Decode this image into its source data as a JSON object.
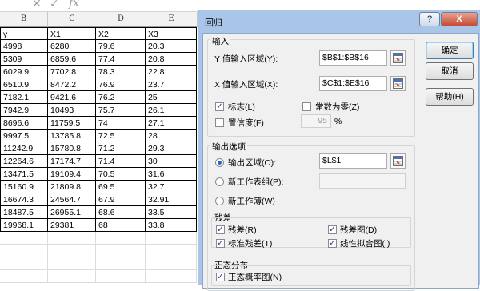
{
  "toolbar": {
    "cancel_icon": "x-icon",
    "enter_icon": "check-icon",
    "fx_label": "fx"
  },
  "columns": [
    "B",
    "C",
    "D",
    "E"
  ],
  "rows": [
    [
      "y",
      "X1",
      "X2",
      "X3"
    ],
    [
      "4998",
      "6280",
      "79.6",
      "20.3"
    ],
    [
      "5309",
      "6859.6",
      "77.4",
      "20.8"
    ],
    [
      "6029.9",
      "7702.8",
      "78.3",
      "22.8"
    ],
    [
      "6510.9",
      "8472.2",
      "76.9",
      "23.7"
    ],
    [
      "7182.1",
      "9421.6",
      "76.2",
      "25"
    ],
    [
      "7942.9",
      "10493",
      "75.7",
      "26.1"
    ],
    [
      "8696.6",
      "11759.5",
      "74",
      "27.1"
    ],
    [
      "9997.5",
      "13785.8",
      "72.5",
      "28"
    ],
    [
      "11242.9",
      "15780.8",
      "71.2",
      "29.3"
    ],
    [
      "12264.6",
      "17174.7",
      "71.4",
      "30"
    ],
    [
      "13471.5",
      "19109.4",
      "70.5",
      "31.6"
    ],
    [
      "15160.9",
      "21809.8",
      "69.5",
      "32.7"
    ],
    [
      "16674.3",
      "24564.7",
      "67.9",
      "32.91"
    ],
    [
      "18487.5",
      "26955.1",
      "68.6",
      "33.5"
    ],
    [
      "19968.1",
      "29381",
      "68",
      "33.8"
    ]
  ],
  "dialog": {
    "title": "回归",
    "help_btn": "?",
    "close_btn": "X",
    "input_group": "输入",
    "y_label": "Y 值输入区域(Y):",
    "y_value": "$B$1:$B$16",
    "x_label": "X 值输入区域(X):",
    "x_value": "$C$1:$E$16",
    "labels_chk": "标志(L)",
    "labels_checked": true,
    "const_zero_chk": "常数为零(Z)",
    "const_zero_checked": false,
    "confidence_chk": "置信度(F)",
    "confidence_checked": false,
    "confidence_value": "95",
    "percent": "%",
    "output_group": "输出选项",
    "out_range_label": "输出区域(O):",
    "out_range_value": "$L$1",
    "new_sheet_label": "新工作表组(P):",
    "new_book_label": "新工作薄(W)",
    "selected_output": "output_range",
    "residuals_title": "残差",
    "residuals_chk": "残差(R)",
    "std_residuals_chk": "标准残差(T)",
    "residual_plot_chk": "残差图(D)",
    "line_fit_chk": "线性拟合图(I)",
    "normal_title": "正态分布",
    "normal_plot_chk": "正态概率图(N)",
    "ok": "确定",
    "cancel": "取消",
    "help": "帮助(H)"
  }
}
